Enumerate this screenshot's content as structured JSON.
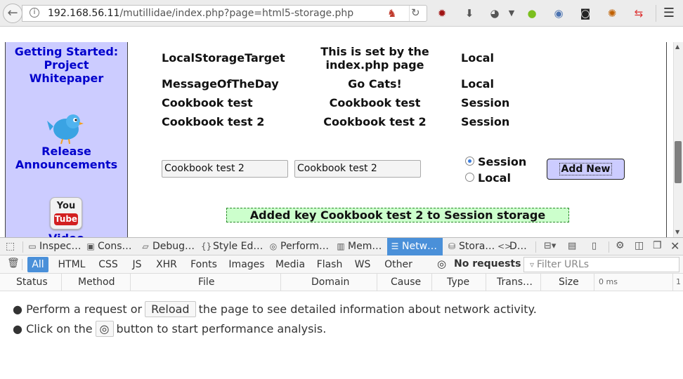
{
  "browser": {
    "url_host": "192.168.56.11",
    "url_path": "/mutillidae/index.php?page=html5-storage.php"
  },
  "sidebar": {
    "getting_started": [
      "Getting Started:",
      "Project",
      "Whitepaper"
    ],
    "release": [
      "Release",
      "Announcements"
    ],
    "video_label": "Video",
    "youtube_top": "You",
    "youtube_bottom": "Tube"
  },
  "storage_table": {
    "rows": [
      {
        "key": "LocalStorageTarget",
        "value_line1": "This is set by the",
        "value_line2": "index.php page",
        "type": "Local"
      },
      {
        "key": "MessageOfTheDay",
        "value": "Go Cats!",
        "type": "Local"
      },
      {
        "key": "Cookbook test",
        "value": "Cookbook test",
        "type": "Session"
      },
      {
        "key": "Cookbook test 2",
        "value": "Cookbook test 2",
        "type": "Session"
      }
    ]
  },
  "form": {
    "key_input": "Cookbook test 2",
    "value_input": "Cookbook test 2",
    "radio_session": "Session",
    "radio_local": "Local",
    "selected": "Session",
    "add_button": "Add New"
  },
  "status_message": "Added key Cookbook test 2 to Session storage",
  "devtools": {
    "tabs": [
      "Inspec…",
      "Cons…",
      "Debug…",
      "Style Ed…",
      "Perform…",
      "Mem…",
      "Netw…",
      "Stora…",
      "D…"
    ],
    "selected_tab": "Netw…",
    "filters": [
      "All",
      "HTML",
      "CSS",
      "JS",
      "XHR",
      "Fonts",
      "Images",
      "Media",
      "Flash",
      "WS",
      "Other"
    ],
    "selected_filter": "All",
    "no_requests": "No requests",
    "filter_placeholder": "Filter URLs",
    "columns": [
      "Status",
      "Method",
      "File",
      "Domain",
      "Cause",
      "Type",
      "Trans…",
      "Size"
    ],
    "timeline_label": "0 ms",
    "timeline_end": "1",
    "msg1_before": "Perform a request or",
    "msg1_button": "Reload",
    "msg1_after": "the page to see detailed information about network activity.",
    "msg2_before": "Click on the",
    "msg2_after": "button to start performance analysis."
  }
}
